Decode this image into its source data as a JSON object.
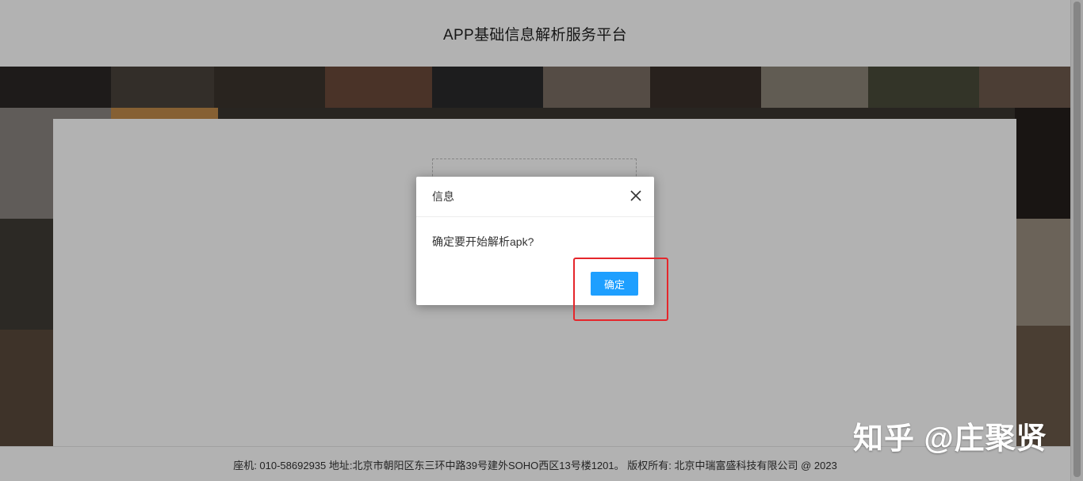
{
  "header": {
    "title": "APP基础信息解析服务平台"
  },
  "footer": {
    "text": "座机: 010-58692935 地址:北京市朝阳区东三环中路39号建外SOHO西区13号楼1201。 版权所有: 北京中瑞富盛科技有限公司 @ 2023"
  },
  "dialog": {
    "title": "信息",
    "message": "确定要开始解析apk?",
    "confirm_label": "确定",
    "close_icon": "close-icon"
  },
  "watermark": {
    "text": "知乎 @庄聚贤"
  },
  "colors": {
    "primary_button": "#1e9fff",
    "highlight_border": "#e5262b",
    "overlay": "rgba(0,0,0,0.3)"
  }
}
